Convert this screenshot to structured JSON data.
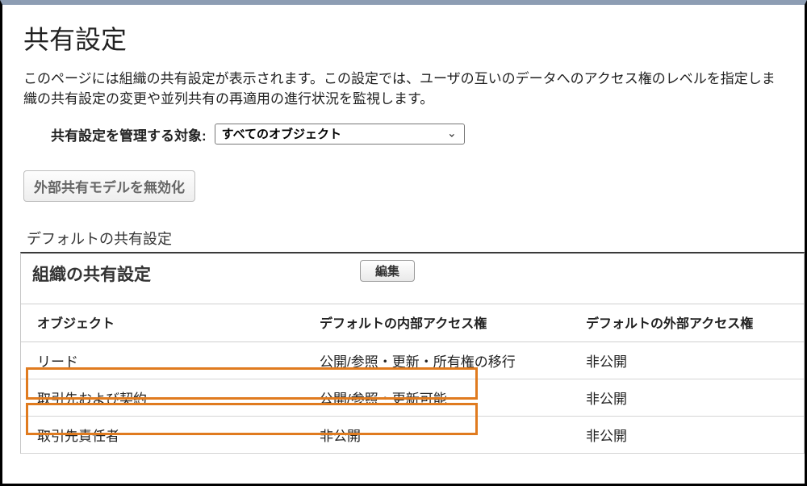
{
  "page": {
    "title": "共有設定",
    "description_line1": "このページには組織の共有設定が表示されます。この設定では、ユーザの互いのデータへのアクセス権のレベルを指定しま",
    "description_line2": "織の共有設定の変更や並列共有の再適用の進行状況を監視します。"
  },
  "manage": {
    "label": "共有設定を管理する対象:",
    "selected": "すべてのオブジェクト"
  },
  "buttons": {
    "disable_external": "外部共有モデルを無効化",
    "edit": "編集"
  },
  "sections": {
    "defaults_label": "デフォルトの共有設定",
    "org_wide_title": "組織の共有設定"
  },
  "table": {
    "headers": {
      "object": "オブジェクト",
      "internal": "デフォルトの内部アクセス権",
      "external": "デフォルトの外部アクセス権"
    },
    "rows": [
      {
        "object": "リード",
        "internal": "公開/参照・更新・所有権の移行",
        "external": "非公開"
      },
      {
        "object": "取引先および契約",
        "internal": "公開/参照・更新可能",
        "external": "非公開"
      },
      {
        "object": "取引先責任者",
        "internal": "非公開",
        "external": "非公開"
      }
    ]
  }
}
